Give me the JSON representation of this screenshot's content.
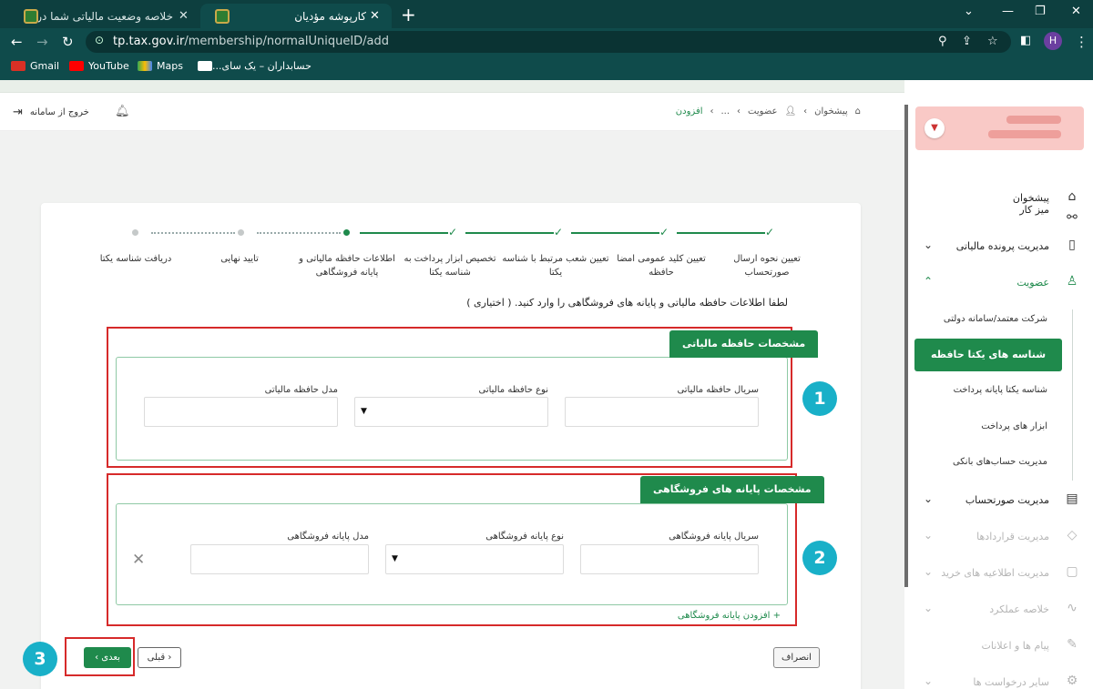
{
  "browser": {
    "tabs": [
      {
        "title": "خلاصه وضعیت مالیاتی شما در نظا",
        "close": "✕"
      },
      {
        "title": "کارپوشه مؤدیان",
        "close": "✕"
      }
    ],
    "new_tab": "+",
    "url_host": "tp.tax.gov.ir",
    "url_path": "/membership/normalUniqueID/add",
    "profile_initial": "H",
    "bookmarks": [
      "Gmail",
      "YouTube",
      "Maps",
      "حسابداران – یک سای..."
    ]
  },
  "topnav": {
    "logout_label": "خروج از سامانه",
    "breadcrumbs": [
      "پیشخوان",
      "عضویت",
      "...",
      "افزودن"
    ]
  },
  "stepper": {
    "steps": [
      {
        "label": "تعیین نحوه ارسال صورتحساب",
        "status": "done"
      },
      {
        "label": "تعیین کلید عمومی امضا حافظه",
        "status": "done"
      },
      {
        "label": "تعیین شعب مرتبط با شناسه یکتا",
        "status": "done"
      },
      {
        "label": "تخصیص ابزار پرداخت به شناسه یکتا",
        "status": "done"
      },
      {
        "label": "اطلاعات حافظه مالیاتی و پایانه فروشگاهی",
        "status": "current"
      },
      {
        "label": "تایید نهایی",
        "status": "todo"
      },
      {
        "label": "دریافت شناسه یکتا",
        "status": "todo"
      }
    ]
  },
  "form": {
    "instruction": "لطفا اطلاعات حافظه مالیاتی و پایانه های فروشگاهی را وارد کنید. ( اختیاری )",
    "memory_section": {
      "title": "مشخصات حافظه مالیاتی",
      "serial_label": "سریال حافظه مالیاتی",
      "type_label": "نوع حافظه مالیاتی",
      "model_label": "مدل حافظه مالیاتی"
    },
    "terminal_section": {
      "title": "مشخصات پایانه های فروشگاهی",
      "serial_label": "سریال پایانه فروشگاهی",
      "type_label": "نوع پایانه فروشگاهی",
      "model_label": "مدل پایانه فروشگاهی",
      "remove": "✕"
    },
    "add_terminal": "+ افزودن پایانه فروشگاهی"
  },
  "buttons": {
    "next": "بعدی",
    "prev": "قبلی",
    "cancel": "انصراف"
  },
  "annotations": [
    "1",
    "2",
    "3"
  ],
  "sidebar": {
    "items": [
      {
        "label": "پیشخوان",
        "icon": "home-icon",
        "state": "normal"
      },
      {
        "label": "میز کار",
        "icon": "workspace-icon",
        "state": "normal"
      },
      {
        "label": "مدیریت پرونده مالیاتی",
        "icon": "file-icon",
        "state": "normal"
      },
      {
        "label": "عضویت",
        "icon": "user-icon",
        "state": "open"
      },
      {
        "label": "مدیریت صورتحساب",
        "icon": "invoice-icon",
        "state": "normal"
      },
      {
        "label": "مدیریت قراردادها",
        "icon": "contract-icon",
        "state": "muted"
      },
      {
        "label": "مدیریت اطلاعیه های خرید",
        "icon": "purchase-icon",
        "state": "muted"
      },
      {
        "label": "خلاصه عملکرد",
        "icon": "summary-icon",
        "state": "muted"
      },
      {
        "label": "پیام ها و اعلانات",
        "icon": "message-icon",
        "state": "muted"
      },
      {
        "label": "سایر درخواست ها",
        "icon": "request-icon",
        "state": "muted"
      }
    ],
    "membership_sub": [
      "شرکت معتمد/سامانه دولتی",
      "شناسه های یکتا حافظه مالیاتی",
      "شناسه یکتا پایانه پرداخت",
      "ابزار های پرداخت",
      "مدیریت حساب‌های بانکی"
    ]
  },
  "colors": {
    "primary": "#1f8a4c",
    "annotation": "#19b0c8",
    "highlight_border": "#d62a2a",
    "browser_frame": "#0f4b4b"
  }
}
